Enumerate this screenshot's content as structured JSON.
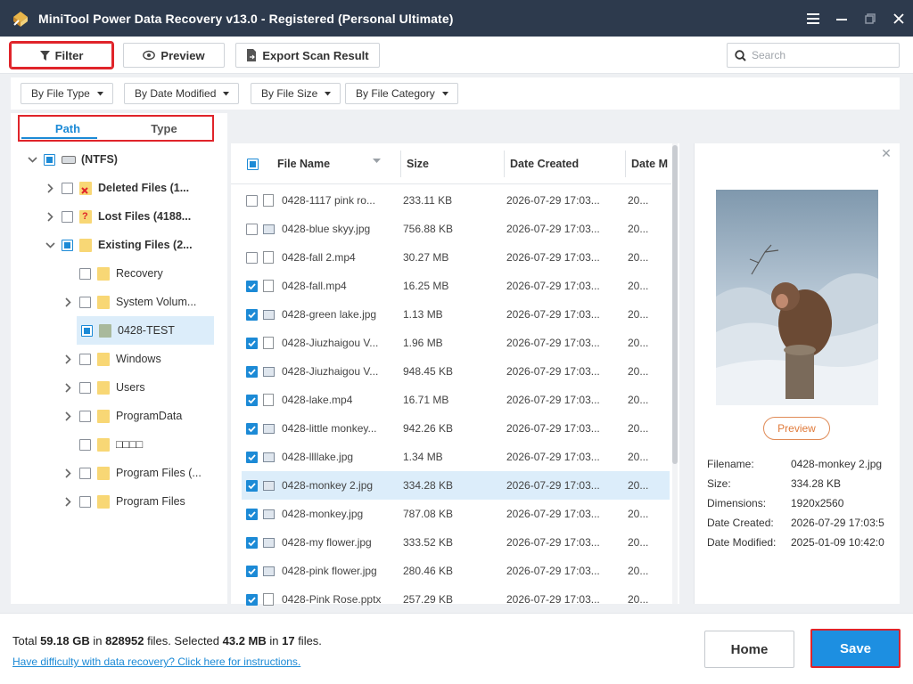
{
  "app": {
    "title": "MiniTool Power Data Recovery v13.0 - Registered (Personal Ultimate)"
  },
  "toolbar": {
    "filter_label": "Filter",
    "preview_label": "Preview",
    "export_label": "Export Scan Result",
    "search_placeholder": "Search"
  },
  "filters": [
    {
      "label": "By File Type"
    },
    {
      "label": "By Date Modified"
    },
    {
      "label": "By File Size"
    },
    {
      "label": "By File Category"
    }
  ],
  "tabs": [
    {
      "label": "Path",
      "active": true
    },
    {
      "label": "Type",
      "active": false
    }
  ],
  "tree": [
    {
      "label": "(NTFS)",
      "check": "partial",
      "caret": "down",
      "icon": "drive-icon",
      "bold": true
    },
    {
      "label": "Deleted Files (1...",
      "check": "none",
      "caret": "right",
      "icon": "deleted-folder-icon",
      "bold": true
    },
    {
      "label": "Lost Files (4188...",
      "check": "none",
      "caret": "right",
      "icon": "lost-folder-icon",
      "bold": true
    },
    {
      "label": "Existing Files (2...",
      "check": "partial",
      "caret": "down",
      "icon": "folder-icon",
      "bold": true
    },
    {
      "label": "Recovery",
      "check": "none",
      "caret": "",
      "icon": "folder-icon",
      "bold": false
    },
    {
      "label": "System Volum...",
      "check": "none",
      "caret": "right",
      "icon": "folder-icon",
      "bold": false
    },
    {
      "label": "0428-TEST",
      "check": "partial",
      "caret": "",
      "icon": "folder-gray-icon",
      "bold": false,
      "selected": true
    },
    {
      "label": "Windows",
      "check": "none",
      "caret": "right",
      "icon": "folder-icon",
      "bold": false
    },
    {
      "label": "Users",
      "check": "none",
      "caret": "right",
      "icon": "folder-icon",
      "bold": false
    },
    {
      "label": "ProgramData",
      "check": "none",
      "caret": "right",
      "icon": "folder-icon",
      "bold": false
    },
    {
      "label": "□□□□",
      "check": "none",
      "caret": "",
      "icon": "folder-icon",
      "bold": false
    },
    {
      "label": "Program Files (...",
      "check": "none",
      "caret": "right",
      "icon": "folder-icon",
      "bold": false
    },
    {
      "label": "Program Files",
      "check": "none",
      "caret": "right",
      "icon": "folder-icon",
      "bold": false
    }
  ],
  "file_list": {
    "columns": [
      "File Name",
      "Size",
      "Date Created",
      "Date M"
    ],
    "header_check": "partial",
    "rows": [
      {
        "name": "0428-1117 pink ro...",
        "size": "233.11 KB",
        "created": "2026-07-29 17:03...",
        "modified": "20...",
        "checked": false,
        "icon": "file-icon"
      },
      {
        "name": "0428-blue skyy.jpg",
        "size": "756.88 KB",
        "created": "2026-07-29 17:03...",
        "modified": "20...",
        "checked": false,
        "icon": "image-icon"
      },
      {
        "name": "0428-fall 2.mp4",
        "size": "30.27 MB",
        "created": "2026-07-29 17:03...",
        "modified": "20...",
        "checked": false,
        "icon": "file-icon"
      },
      {
        "name": "0428-fall.mp4",
        "size": "16.25 MB",
        "created": "2026-07-29 17:03...",
        "modified": "20...",
        "checked": true,
        "icon": "file-icon"
      },
      {
        "name": "0428-green lake.jpg",
        "size": "1.13 MB",
        "created": "2026-07-29 17:03...",
        "modified": "20...",
        "checked": true,
        "icon": "image-icon"
      },
      {
        "name": "0428-Jiuzhaigou V...",
        "size": "1.96 MB",
        "created": "2026-07-29 17:03...",
        "modified": "20...",
        "checked": true,
        "icon": "file-icon"
      },
      {
        "name": "0428-Jiuzhaigou V...",
        "size": "948.45 KB",
        "created": "2026-07-29 17:03...",
        "modified": "20...",
        "checked": true,
        "icon": "image-icon"
      },
      {
        "name": "0428-lake.mp4",
        "size": "16.71 MB",
        "created": "2026-07-29 17:03...",
        "modified": "20...",
        "checked": true,
        "icon": "file-icon"
      },
      {
        "name": "0428-little monkey...",
        "size": "942.26 KB",
        "created": "2026-07-29 17:03...",
        "modified": "20...",
        "checked": true,
        "icon": "image-icon"
      },
      {
        "name": "0428-llllake.jpg",
        "size": "1.34 MB",
        "created": "2026-07-29 17:03...",
        "modified": "20...",
        "checked": true,
        "icon": "image-icon"
      },
      {
        "name": "0428-monkey 2.jpg",
        "size": "334.28 KB",
        "created": "2026-07-29 17:03...",
        "modified": "20...",
        "checked": true,
        "icon": "image-icon",
        "selected": true
      },
      {
        "name": "0428-monkey.jpg",
        "size": "787.08 KB",
        "created": "2026-07-29 17:03...",
        "modified": "20...",
        "checked": true,
        "icon": "image-icon"
      },
      {
        "name": "0428-my flower.jpg",
        "size": "333.52 KB",
        "created": "2026-07-29 17:03...",
        "modified": "20...",
        "checked": true,
        "icon": "image-icon"
      },
      {
        "name": "0428-pink flower.jpg",
        "size": "280.46 KB",
        "created": "2026-07-29 17:03...",
        "modified": "20...",
        "checked": true,
        "icon": "image-icon"
      },
      {
        "name": "0428-Pink Rose.pptx",
        "size": "257.29 KB",
        "created": "2026-07-29 17:03...",
        "modified": "20...",
        "checked": true,
        "icon": "file-icon"
      }
    ]
  },
  "preview": {
    "button_label": "Preview",
    "meta": [
      {
        "key": "Filename:",
        "value": "0428-monkey 2.jpg"
      },
      {
        "key": "Size:",
        "value": "334.28 KB"
      },
      {
        "key": "Dimensions:",
        "value": "1920x2560"
      },
      {
        "key": "Date Created:",
        "value": "2026-07-29 17:03:5"
      },
      {
        "key": "Date Modified:",
        "value": "2025-01-09 10:42:0"
      }
    ]
  },
  "footer": {
    "total_prefix": "Total ",
    "total_size": "59.18 GB",
    "in1": " in ",
    "total_files": "828952",
    "files1": " files.  Selected ",
    "selected_size": "43.2 MB",
    "in2": " in ",
    "selected_files": "17",
    "files2": " files.",
    "help_link": "Have difficulty with data recovery? Click here for instructions.",
    "home_label": "Home",
    "save_label": "Save"
  },
  "colors": {
    "titlebar": "#2d3a4d",
    "accent": "#1c8ad6",
    "highlight_box": "#e0242a",
    "save_button": "#1d8fe1",
    "preview_button": "#e07a3a"
  }
}
